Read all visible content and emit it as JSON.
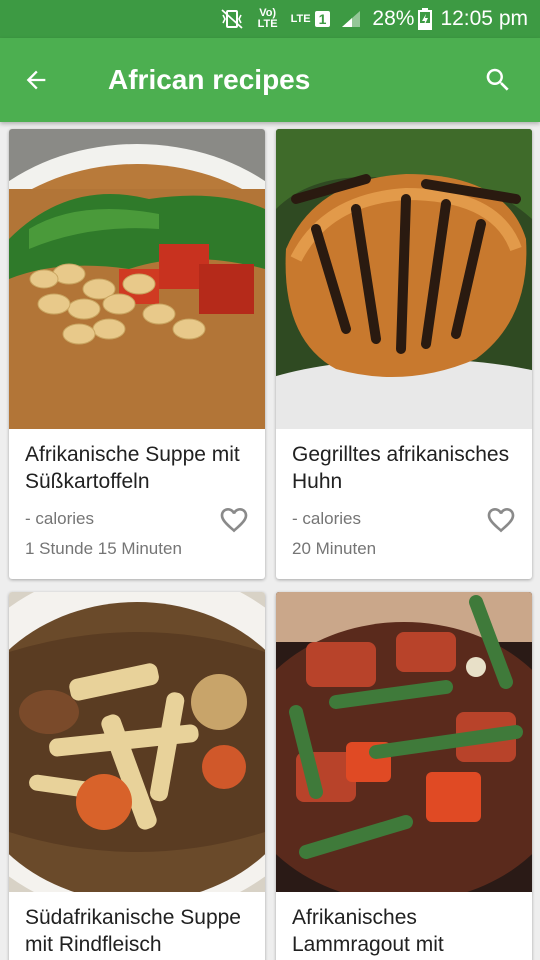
{
  "status_bar": {
    "network_label": "Vo) LTE",
    "lte_label": "LTE",
    "sim_number": "1",
    "battery": "28%",
    "time": "12:05 pm"
  },
  "app_bar": {
    "title": "African recipes",
    "icons": {
      "back": "arrow-back-icon",
      "search": "search-icon"
    }
  },
  "recipes": [
    {
      "name": "Afrikanische Suppe mit Süßkartoffeln",
      "calories": "- calories",
      "time": "1 Stunde 15 Minuten",
      "image": "peanut soup with sweet potato, herbs and peanuts"
    },
    {
      "name": "Gegrilltes afrikanisches Huhn",
      "calories": "- calories",
      "time": "20 Minuten",
      "image": "grilled chicken on plate"
    },
    {
      "name": "Südafrikanische Suppe mit Rindfleisch",
      "calories": "",
      "time": "",
      "image": "beef soup with potatoes and carrots"
    },
    {
      "name": "Afrikanisches Lammragout mit",
      "calories": "",
      "time": "",
      "image": "lamb ragout with okra and tomato"
    }
  ],
  "colors": {
    "status_bar": "#3d9a43",
    "app_bar": "#4caf50",
    "background": "#eeeeee"
  }
}
